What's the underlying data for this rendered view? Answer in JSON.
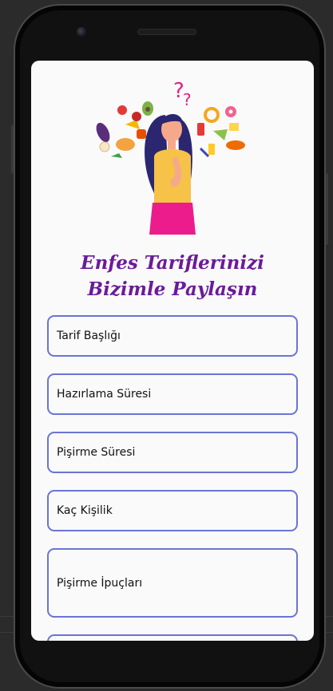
{
  "form": {
    "title_line1": "Enfes Tariflerinizi",
    "title_line2": "Bizimle Paylaşın",
    "fields": [
      {
        "label": "Tarif Başlığı"
      },
      {
        "label": "Hazırlama Süresi"
      },
      {
        "label": "Pişirme Süresi"
      },
      {
        "label": "Kaç Kişilik"
      },
      {
        "label": "Pişirme İpuçları"
      },
      {
        "label": ""
      }
    ]
  },
  "colors": {
    "title": "#6a1b9a",
    "field_border": "#6b74d4",
    "screen_background": "#fafafa",
    "device": "#111111"
  },
  "icons": {
    "illustration": "woman-thinking-about-food-illustration",
    "camera": "front-camera-icon",
    "speaker": "earpiece-speaker"
  }
}
